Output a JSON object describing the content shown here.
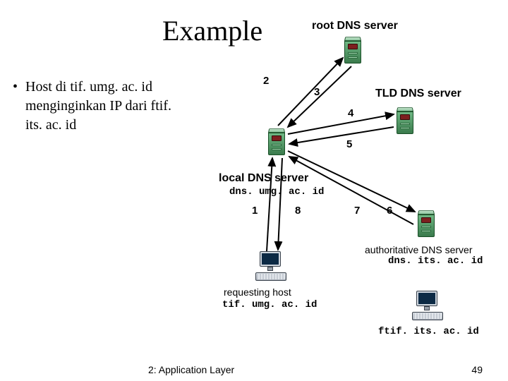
{
  "title": "Example",
  "bullet": "Host di tif. umg. ac. id menginginkan IP dari ftif. its. ac. id",
  "labels": {
    "root": "root DNS server",
    "tld": "TLD DNS server",
    "local": "local DNS server",
    "local_host": "dns. umg. ac. id",
    "requesting": "requesting host",
    "requesting_host": "tif. umg. ac. id",
    "auth": "authoritative DNS server",
    "auth_host": "dns. its. ac. id",
    "ftif_host": "ftif. its. ac. id"
  },
  "steps": {
    "n1": "1",
    "n2": "2",
    "n3": "3",
    "n4": "4",
    "n5": "5",
    "n6": "6",
    "n7": "7",
    "n8": "8"
  },
  "footer": {
    "left": "2: Application Layer",
    "right": "49"
  }
}
